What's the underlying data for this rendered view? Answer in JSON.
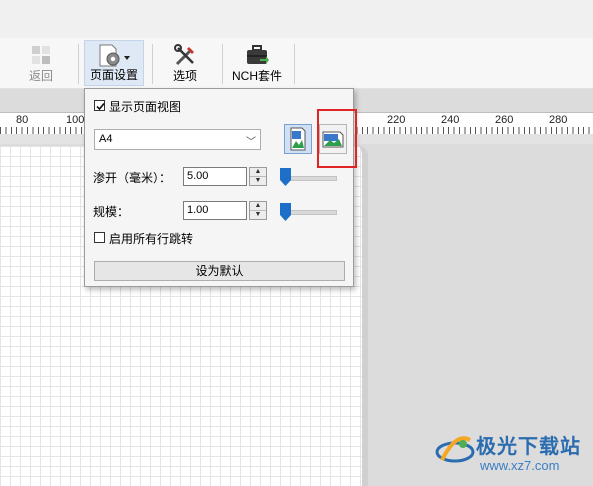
{
  "toolbar": {
    "back_label": "返回",
    "page_setup_label": "页面设置",
    "options_label": "选项",
    "nch_suite_label": "NCH套件"
  },
  "ruler": {
    "labels": [
      "80",
      "100",
      "220",
      "240",
      "260",
      "280"
    ]
  },
  "popup": {
    "show_page_view_label": "显示页面视图",
    "show_page_view_checked": true,
    "paper_size": "A4",
    "bleed_label": "渗开（毫米）：",
    "bleed_value": "5.00",
    "scale_label": "规模：",
    "scale_value": "1.00",
    "enable_all_line_jumps_label": "启用所有行跳转",
    "enable_all_line_jumps_checked": false,
    "set_default_label": "设为默认"
  },
  "watermark": {
    "title": "极光下载站",
    "url": "www.xz7.com"
  },
  "colors": {
    "accent": "#1e6fc8",
    "highlight": "#e02424",
    "watermark": "#2b6cb0"
  },
  "icons": [
    "back-icon",
    "page-setup-icon",
    "options-icon",
    "nch-suite-icon",
    "portrait-icon",
    "landscape-icon",
    "checkbox-icon",
    "dropdown-arrow-icon"
  ]
}
